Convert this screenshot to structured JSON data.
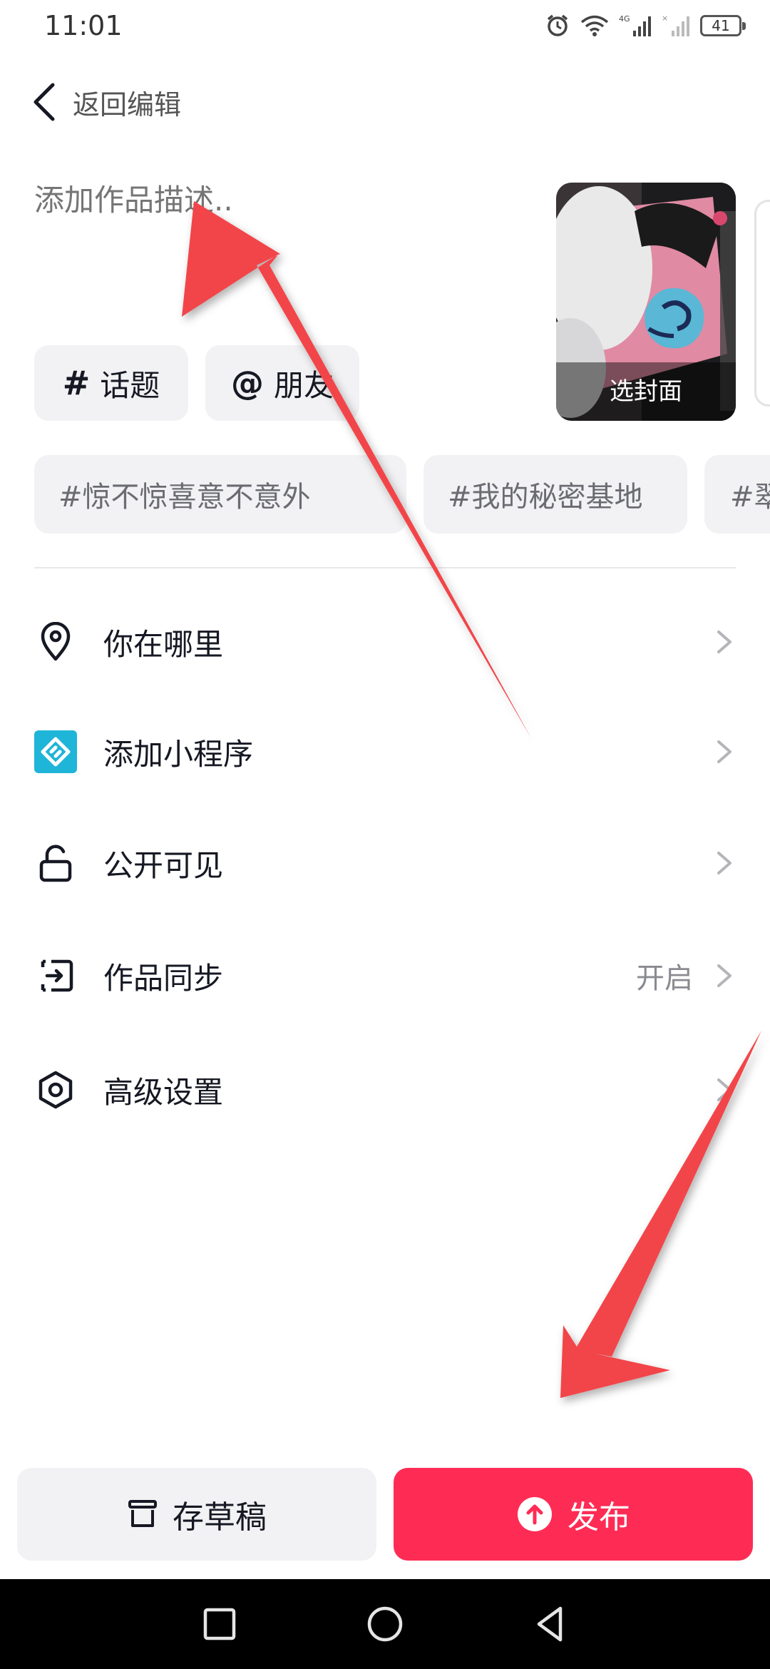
{
  "status_bar": {
    "time": "11:01",
    "battery": "41",
    "network": "4G"
  },
  "header": {
    "back_label": "返回编辑"
  },
  "description": {
    "placeholder": "添加作品描述.."
  },
  "cover": {
    "label": "选封面"
  },
  "chips": {
    "topic": "话题",
    "mention": "朋友"
  },
  "tags": [
    "#惊不惊喜意不意外",
    "#我的秘密基地",
    "#翠"
  ],
  "menu": [
    {
      "label": "你在哪里",
      "icon": "location-pin-icon",
      "value": ""
    },
    {
      "label": "添加小程序",
      "icon": "mini-program-icon",
      "value": ""
    },
    {
      "label": "公开可见",
      "icon": "unlock-icon",
      "value": ""
    },
    {
      "label": "作品同步",
      "icon": "sync-icon",
      "value": "开启"
    },
    {
      "label": "高级设置",
      "icon": "settings-hexagon-icon",
      "value": ""
    }
  ],
  "actions": {
    "draft_label": "存草稿",
    "publish_label": "发布"
  },
  "colors": {
    "accent": "#fe2c55",
    "mini_program": "#1fb5d8",
    "arrow": "#f2454a"
  }
}
